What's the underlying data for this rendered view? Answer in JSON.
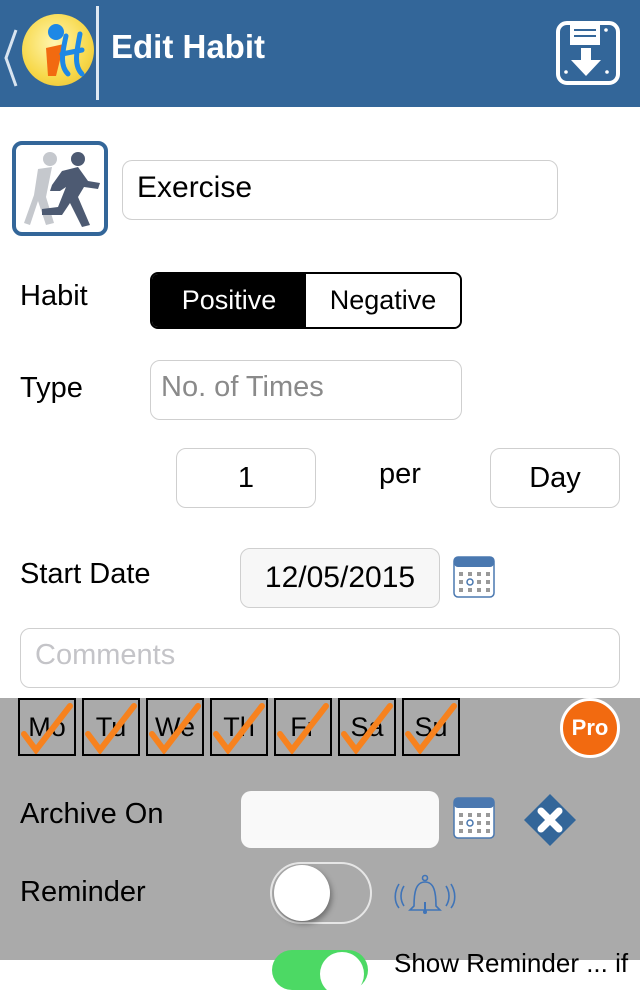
{
  "header": {
    "title": "Edit Habit",
    "back_icon": "chevron-left-icon",
    "logo": "ihabit-logo",
    "save_icon": "save-download-icon",
    "background": "#336699"
  },
  "habit": {
    "icon": "running-person-icon",
    "name": "Exercise"
  },
  "habit_type": {
    "label": "Habit",
    "options": [
      "Positive",
      "Negative"
    ],
    "selected": "Positive"
  },
  "type": {
    "label": "Type",
    "placeholder": "No. of Times"
  },
  "frequency": {
    "count": "1",
    "per_label": "per",
    "period": "Day"
  },
  "start_date": {
    "label": "Start Date",
    "value": "12/05/2015",
    "calendar_icon": "calendar-icon"
  },
  "comments": {
    "placeholder": "Comments"
  },
  "days": {
    "items": [
      {
        "label": "Mo",
        "checked": true
      },
      {
        "label": "Tu",
        "checked": true
      },
      {
        "label": "We",
        "checked": true
      },
      {
        "label": "Th",
        "checked": true
      },
      {
        "label": "Fr",
        "checked": true
      },
      {
        "label": "Sa",
        "checked": true
      },
      {
        "label": "Su",
        "checked": true
      }
    ],
    "check_color": "#f7821e"
  },
  "pro_badge": {
    "label": "Pro",
    "color": "#f26a10"
  },
  "archive": {
    "label": "Archive On",
    "value": "",
    "calendar_icon": "calendar-icon",
    "clear_icon": "clear-x-icon"
  },
  "reminder": {
    "label": "Reminder",
    "enabled": false,
    "bell_icon": "bell-ringing-icon"
  },
  "show_reminder": {
    "enabled": true,
    "label": "Show Reminder ... if",
    "toggle_color": "#4cd964"
  }
}
